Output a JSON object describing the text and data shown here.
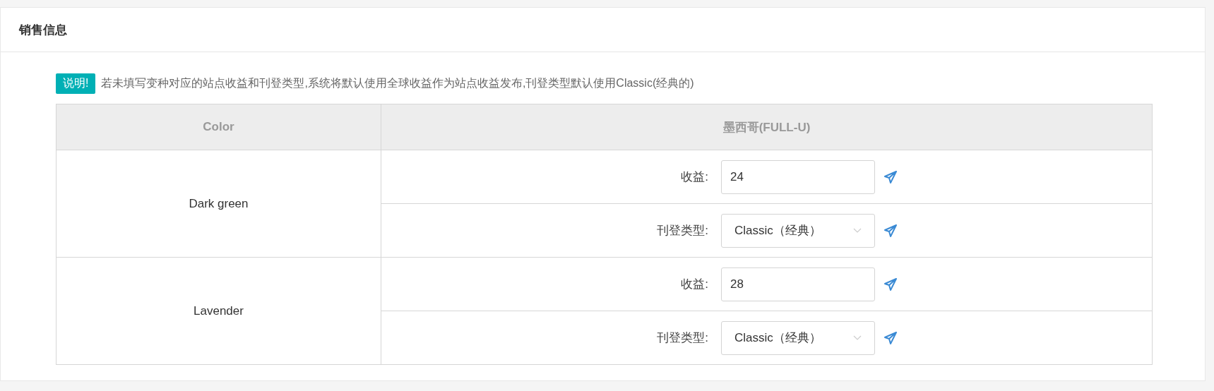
{
  "panel": {
    "title": "销售信息"
  },
  "notice": {
    "badge": "说明!",
    "text": "若未填写变种对应的站点收益和刊登类型,系统将默认使用全球收益作为站点收益发布,刊登类型默认使用Classic(经典的)"
  },
  "table": {
    "columns": [
      "Color",
      "墨西哥(FULL-U)"
    ],
    "rows": [
      {
        "variant": "Dark green",
        "fields": [
          {
            "kind": "input",
            "label": "收益:",
            "value": "24"
          },
          {
            "kind": "select",
            "label": "刊登类型:",
            "value": "Classic（经典）"
          }
        ]
      },
      {
        "variant": "Lavender",
        "fields": [
          {
            "kind": "input",
            "label": "收益:",
            "value": "28"
          },
          {
            "kind": "select",
            "label": "刊登类型:",
            "value": "Classic（经典）"
          }
        ]
      }
    ]
  }
}
